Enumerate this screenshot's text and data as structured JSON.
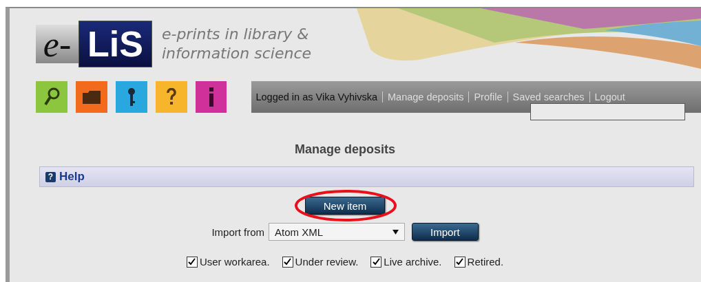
{
  "logo": {
    "prefix": "e-",
    "name": "LiS"
  },
  "tagline": [
    "e-prints in library &",
    "information science"
  ],
  "icon_tiles": [
    {
      "kind": "search",
      "color": "#8cc63f"
    },
    {
      "kind": "folder",
      "color": "#f26b1d"
    },
    {
      "kind": "key",
      "color": "#29a8e0"
    },
    {
      "kind": "help",
      "color": "#f7b52c"
    },
    {
      "kind": "info",
      "color": "#d0309a"
    }
  ],
  "user_bar": {
    "status": "Logged in as Vika Vyhivska",
    "links": [
      "Manage deposits",
      "Profile",
      "Saved searches",
      "Logout"
    ]
  },
  "page_title": "Manage deposits",
  "help": {
    "icon": "?",
    "label": "Help"
  },
  "new_item_button": {
    "label": "New item",
    "highlighted": true
  },
  "import": {
    "label": "Import from",
    "format": "Atom XML",
    "button": "Import"
  },
  "filters": [
    {
      "label": "User workarea.",
      "checked": true
    },
    {
      "label": "Under review.",
      "checked": true
    },
    {
      "label": "Live archive.",
      "checked": true
    },
    {
      "label": "Retired.",
      "checked": true
    }
  ]
}
